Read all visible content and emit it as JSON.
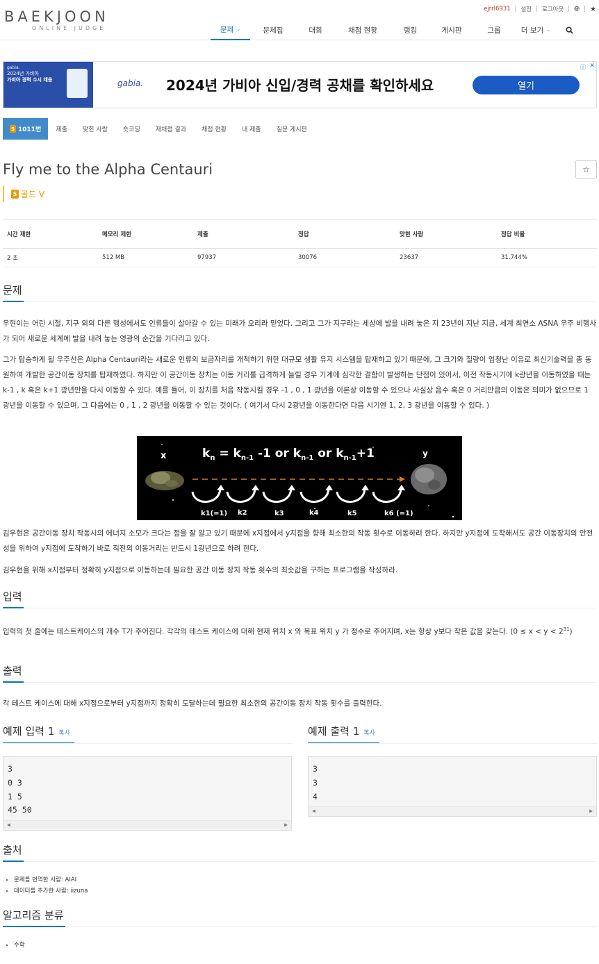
{
  "header": {
    "logo_main": "BAEKJOON",
    "logo_sub": "ONLINE JUDGE",
    "topbar": {
      "username": "ejrrl6931",
      "settings": "설정",
      "logout": "로그아웃"
    },
    "nav": [
      {
        "label": "문제",
        "active": true,
        "dropdown": true
      },
      {
        "label": "문제집"
      },
      {
        "label": "대회"
      },
      {
        "label": "채점 현황"
      },
      {
        "label": "랭킹"
      },
      {
        "label": "게시판"
      },
      {
        "label": "그룹"
      },
      {
        "label": "더 보기",
        "dropdown": true
      }
    ]
  },
  "ad": {
    "thumb_line1": "gabia.",
    "thumb_line2": "2024년 가비아",
    "thumb_line3": "가비아 경력 수시 채용",
    "brand": "gabia.",
    "headline": "2024년 가비아 신입/경력 공채를 확인하세요",
    "button": "열기"
  },
  "problem_menu": [
    {
      "label": "1011번",
      "active": true,
      "tier_badge": "5"
    },
    {
      "label": "제출"
    },
    {
      "label": "맞힌 사람"
    },
    {
      "label": "숏코딩"
    },
    {
      "label": "재채점 결과"
    },
    {
      "label": "채점 현황"
    },
    {
      "label": "내 제출"
    },
    {
      "label": "질문 게시판"
    }
  ],
  "problem": {
    "title": "Fly me to the Alpha Centauri",
    "tier_number": "5",
    "tier_label": "골드 V",
    "star": "☆"
  },
  "info_table": {
    "headers": [
      "시간 제한",
      "메모리 제한",
      "제출",
      "정답",
      "맞힌 사람",
      "정답 비율"
    ],
    "values": [
      "2 초",
      "512 MB",
      "97937",
      "30076",
      "23637",
      "31.744%"
    ]
  },
  "sections": {
    "problem_heading": "문제",
    "problem_p1": "우현이는 어린 시절, 지구 외의 다른 행성에서도 인류들이 살아갈 수 있는 미래가 오리라 믿었다. 그리고 그가 지구라는 세상에 발을 내려 놓은 지 23년이 지난 지금, 세계 최연소 ASNA 우주 비행사가 되어 새로운 세계에 발을 내려 놓는 영광의 순간을 기다리고 있다.",
    "problem_p2": "그가 탑승하게 될 우주선은 Alpha Centauri라는 새로운 인류의 보금자리를 개척하기 위한 대규모 생활 유지 시스템을 탑재하고 있기 때문에, 그 크기와 질량이 엄청난 이유로 최신기술력을 총 동원하여 개발한 공간이동 장치를 탑재하였다. 하지만 이 공간이동 장치는 이동 거리를 급격하게 늘릴 경우 기계에 심각한 결함이 발생하는 단점이 있어서, 이전 작동시기에 k광년을 이동하였을 때는 k-1 , k 혹은 k+1 광년만을 다시 이동할 수 있다. 예를 들어, 이 장치를 처음 작동시킬 경우 -1 , 0 , 1 광년을 이론상 이동할 수 있으나 사실상 음수 혹은 0 거리만큼의 이동은 의미가 없으므로 1 광년을 이동할 수 있으며, 그 다음에는 0 , 1 , 2 광년을 이동할 수 있는 것이다. ( 여기서 다시 2광년을 이동한다면 다음 시기엔 1, 2, 3 광년을 이동할 수 있다. )",
    "diagram": {
      "x_label": "x",
      "y_label": "y",
      "formula_a": "k",
      "formula_n": "n",
      "formula_mid": " = k",
      "formula_n1": "n-1",
      "formula_or": " -1 or k",
      "formula_n1b": "n-1",
      "formula_or2": " or k",
      "formula_n1c": "n-1",
      "formula_plus": "+1",
      "labels": [
        "k1(=1)",
        "k2",
        "k3",
        "k4",
        "k5",
        "k6 (=1)"
      ]
    },
    "problem_p3": "김우현은 공간이동 장치 작동시의 에너지 소모가 크다는 점을 잘 알고 있기 때문에 x지점에서 y지점을 향해 최소한의 작동 횟수로 이동하려 한다. 하지만 y지점에 도착해서도 공간 이동장치의 안전성을 위하여 y지점에 도착하기 바로 직전의 이동거리는 반드시 1광년으로 하려 한다.",
    "problem_p4": "김우현을 위해 x지점부터 정확히 y지점으로 이동하는데 필요한 공간 이동 장치 작동 횟수의 최솟값을 구하는 프로그램을 작성하라.",
    "input_heading": "입력",
    "input_p": "입력의 첫 줄에는 테스트케이스의 개수 T가 주어진다. 각각의 테스트 케이스에 대해 현재 위치 x 와 목표 위치 y 가 정수로 주어지며, x는 항상 y보다 작은 값을 갖는다. (0 ≤ x < y < 2",
    "input_sup": "31",
    "input_end": ")",
    "output_heading": "출력",
    "output_p": "각 테스트 케이스에 대해 x지점으로부터 y지점까지 정확히 도달하는데 필요한 최소한의 공간이동 장치 작동 횟수를 출력한다."
  },
  "samples": {
    "input_title": "예제 입력 1",
    "output_title": "예제 출력 1",
    "copy": "복사",
    "input_code": "3\n0 3\n1 5\n45 50",
    "output_code": "3\n3\n4"
  },
  "source": {
    "heading": "출처",
    "items": [
      "문제를 번역한 사람: AIAI",
      "데이터를 추가한 사람: iizuna"
    ]
  },
  "algorithm": {
    "heading": "알고리즘 분류",
    "items": [
      "수학"
    ]
  }
}
